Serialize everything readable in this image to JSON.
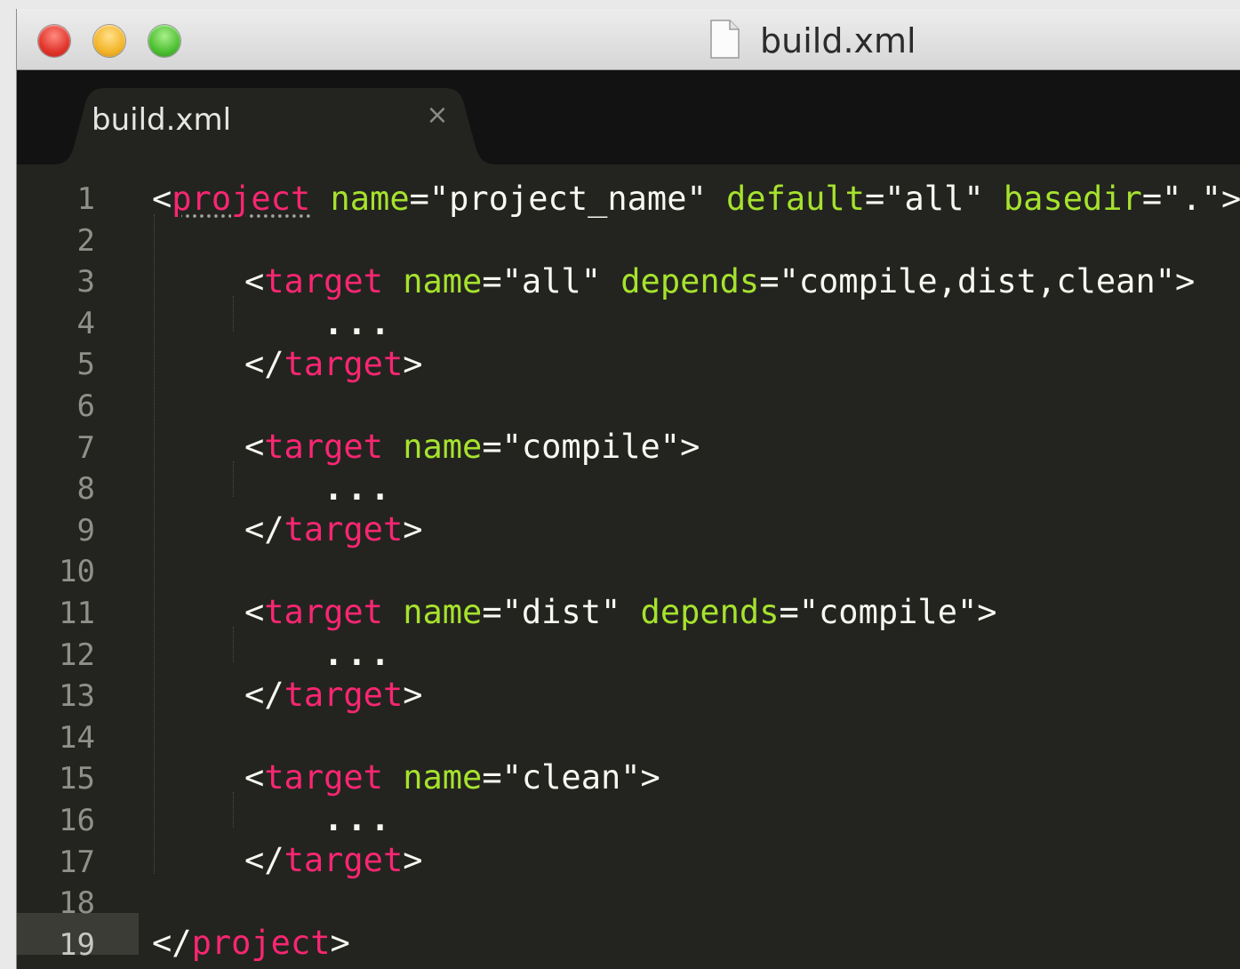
{
  "window": {
    "title": "build.xml"
  },
  "tab": {
    "label": "build.xml",
    "close_glyph": "×"
  },
  "editor": {
    "line_numbers": [
      "1",
      "2",
      "3",
      "4",
      "5",
      "6",
      "7",
      "8",
      "9",
      "10",
      "11",
      "12",
      "13",
      "14",
      "15",
      "16",
      "17",
      "18",
      "19"
    ],
    "active_line": "19",
    "lines": {
      "l1": {
        "open": "<",
        "tag": "project",
        "a1": "name",
        "v1": "=\"project_name\"",
        "a2": "default",
        "v2": "=\"all\"",
        "a3": "basedir",
        "v3": "=\".\"",
        "close": ">"
      },
      "l3": {
        "open": "<",
        "tag": "target",
        "a1": "name",
        "v1": "=\"all\"",
        "a2": "depends",
        "v2": "=\"compile,dist,clean\"",
        "close": ">"
      },
      "l4": {
        "text": "..."
      },
      "l5": {
        "open": "</",
        "tag": "target",
        "close": ">"
      },
      "l7": {
        "open": "<",
        "tag": "target",
        "a1": "name",
        "v1": "=\"compile\"",
        "close": ">"
      },
      "l8": {
        "text": "..."
      },
      "l9": {
        "open": "</",
        "tag": "target",
        "close": ">"
      },
      "l11": {
        "open": "<",
        "tag": "target",
        "a1": "name",
        "v1": "=\"dist\"",
        "a2": "depends",
        "v2": "=\"compile\"",
        "close": ">"
      },
      "l12": {
        "text": "..."
      },
      "l13": {
        "open": "</",
        "tag": "target",
        "close": ">"
      },
      "l15": {
        "open": "<",
        "tag": "target",
        "a1": "name",
        "v1": "=\"clean\"",
        "close": ">"
      },
      "l16": {
        "text": "..."
      },
      "l17": {
        "open": "</",
        "tag": "target",
        "close": ">"
      },
      "l19": {
        "open": "</",
        "tag": "project",
        "close": ">"
      }
    }
  },
  "colors": {
    "background": "#23241f",
    "tag": "#f92672",
    "attribute": "#a6e22e",
    "text": "#f8f8f2",
    "line_number": "#8f908a"
  },
  "icons": {
    "window_controls": [
      "close-button",
      "minimize-button",
      "zoom-button"
    ],
    "title_icon": "document-icon"
  }
}
